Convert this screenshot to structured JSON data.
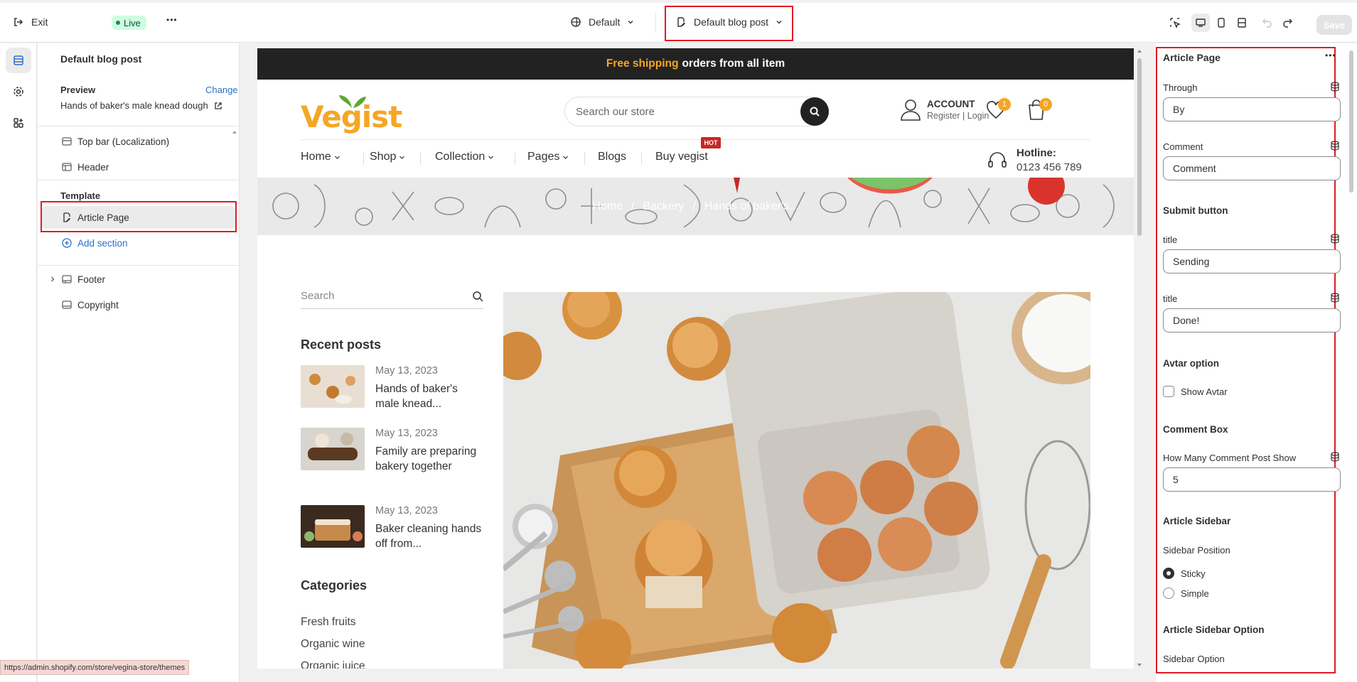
{
  "topbar": {
    "exit_label": "Exit",
    "live_label": "Live",
    "more_label": "•••",
    "theme_selector": "Default",
    "template_selector": "Default blog post",
    "save_label": "Save"
  },
  "sections_panel": {
    "title": "Default blog post",
    "preview_label": "Preview",
    "change_label": "Change",
    "preview_value": "Hands of baker's male knead dough",
    "items_top": [
      "Top bar (Localization)",
      "Header"
    ],
    "template_label": "Template",
    "template_item": "Article Page",
    "add_section": "Add section",
    "items_bottom": [
      "Footer",
      "Copyright"
    ]
  },
  "storefront": {
    "promo_highlight": "Free shipping",
    "promo_text": "orders from all item",
    "logo": "Vegist",
    "search_placeholder": "Search our store",
    "account_title": "ACCOUNT",
    "register": "Register",
    "login": "Login",
    "wishlist_count": "1",
    "cart_count": "0",
    "nav": [
      "Home",
      "Shop",
      "Collection",
      "Pages",
      "Blogs",
      "Buy vegist"
    ],
    "hot_badge": "HOT",
    "hotline_label": "Hotline:",
    "hotline_number": "0123 456 789",
    "breadcrumbs": [
      "Home",
      "Backery",
      "Hands of baker's..."
    ],
    "sidebar_search": "Search",
    "recent_posts_title": "Recent posts",
    "posts": [
      {
        "date": "May 13, 2023",
        "title": "Hands of baker's male knead..."
      },
      {
        "date": "May 13, 2023",
        "title": "Family are preparing bakery together"
      },
      {
        "date": "May 13, 2023",
        "title": "Baker cleaning hands off from..."
      }
    ],
    "categories_title": "Categories",
    "categories": [
      "Fresh fruits",
      "Organic wine",
      "Organic juice"
    ]
  },
  "settings": {
    "title": "Article Page",
    "through_label": "Through",
    "through_value": "By",
    "comment_label": "Comment",
    "comment_value": "Comment",
    "submit_heading": "Submit button",
    "title_label_1": "title",
    "title_value_1": "Sending",
    "title_label_2": "title",
    "title_value_2": "Done!",
    "avatar_heading": "Avtar option",
    "show_avatar": "Show Avtar",
    "comment_box_heading": "Comment Box",
    "comment_count_label": "How Many Comment Post Show",
    "comment_count_value": "5",
    "sidebar_heading": "Article Sidebar",
    "sidebar_position_label": "Sidebar Position",
    "sticky": "Sticky",
    "simple": "Simple",
    "sidebar_option_heading": "Article Sidebar Option",
    "sidebar_option_label": "Sidebar Option"
  },
  "status_url": "https://admin.shopify.com/store/vegina-store/themes",
  "colors": {
    "accent": "#f5a623",
    "highlight_border": "#e01b24",
    "live_bg": "#cdfee1"
  }
}
